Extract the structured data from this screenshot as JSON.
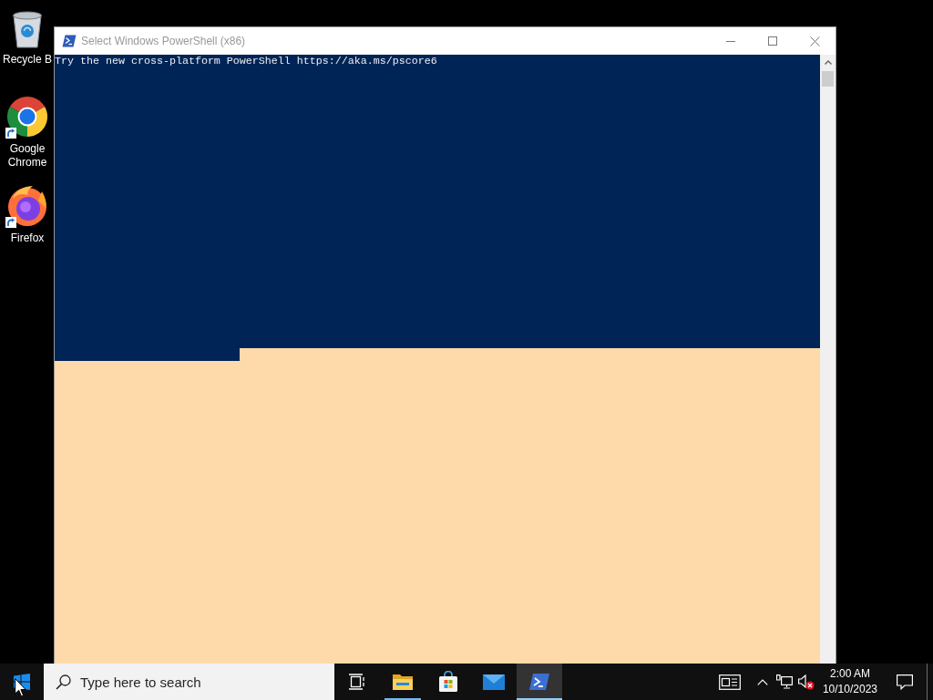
{
  "desktop_icons": [
    {
      "kind": "bin",
      "label": "Recycle B",
      "shortcut": false
    },
    {
      "kind": "chrome",
      "label": "Google Chrome",
      "shortcut": true
    },
    {
      "kind": "firefox",
      "label": "Firefox",
      "shortcut": true
    }
  ],
  "window": {
    "title": "Select Windows PowerShell (x86)",
    "console_lines": [
      "Try the new cross-platform PowerShell https://aka.ms/pscore6"
    ],
    "text_selected": true
  },
  "taskbar": {
    "search": {
      "placeholder": "Type here to search"
    },
    "apps": [
      {
        "kind": "taskview",
        "running": false,
        "selected": false
      },
      {
        "kind": "explorer",
        "running": true,
        "selected": false
      },
      {
        "kind": "store",
        "running": false,
        "selected": false
      },
      {
        "kind": "mail",
        "running": false,
        "selected": false
      },
      {
        "kind": "powershell",
        "running": true,
        "selected": true
      }
    ],
    "tray": {
      "volume_muted": true,
      "time": "2:00 AM",
      "date": "10/10/2023"
    }
  }
}
